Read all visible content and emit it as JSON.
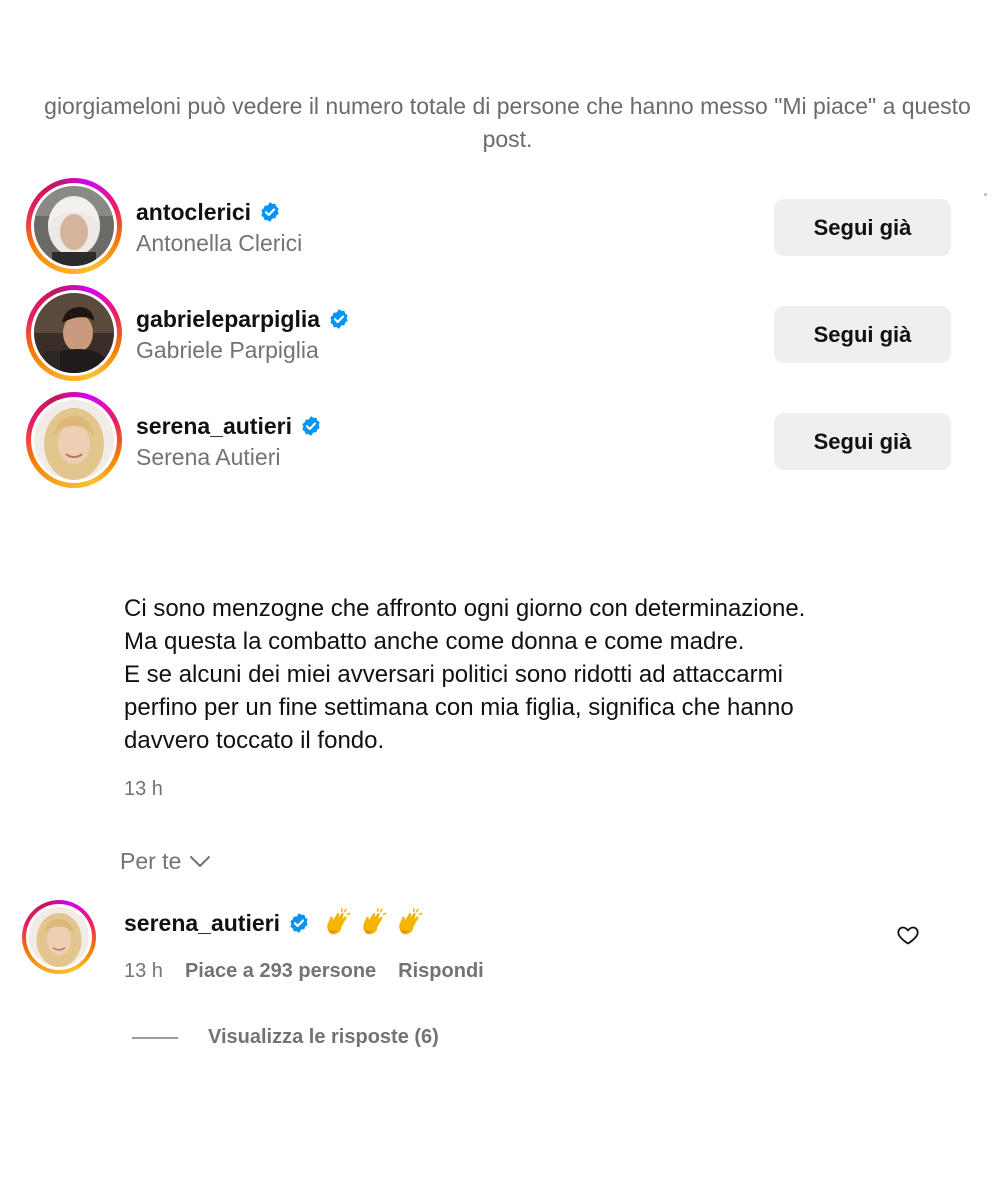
{
  "notice_text": "giorgiameloni può vedere il numero totale di persone che hanno messo \"Mi piace\" a questo post.",
  "likes": [
    {
      "username": "antoclerici",
      "full_name": "Antonella Clerici",
      "button_label": "Segui già",
      "verified": true
    },
    {
      "username": "gabrieleparpiglia",
      "full_name": "Gabriele Parpiglia",
      "button_label": "Segui già",
      "verified": true
    },
    {
      "username": "serena_autieri",
      "full_name": "Serena Autieri",
      "button_label": "Segui già",
      "verified": true
    }
  ],
  "post": {
    "lines": [
      "Ci sono menzogne che affronto ogni giorno con determinazione.",
      "Ma questa la combatto anche come donna e come madre.",
      "E se alcuni dei miei avversari politici sono ridotti ad attaccarmi",
      "perfino per un fine settimana con mia figlia, significa che hanno",
      "davvero toccato il fondo."
    ],
    "time": "13 h"
  },
  "sort": {
    "label": "Per te",
    "icon": "chevron-down-icon"
  },
  "comment": {
    "username": "serena_autieri",
    "verified": true,
    "emojis": [
      "clapping-hands-icon",
      "clapping-hands-icon",
      "clapping-hands-icon"
    ],
    "time": "13 h",
    "likes_text": "Piace a 293 persone",
    "reply_label": "Rispondi",
    "view_replies": "Visualizza le risposte (6)",
    "like_icon": "heart-outline-icon"
  },
  "colors": {
    "verified_blue": "#0095f6",
    "secondary_text": "#737373",
    "button_bg": "#efefef",
    "ring_gradient": [
      "#f9a825",
      "#e91e63",
      "#d500f9"
    ]
  }
}
